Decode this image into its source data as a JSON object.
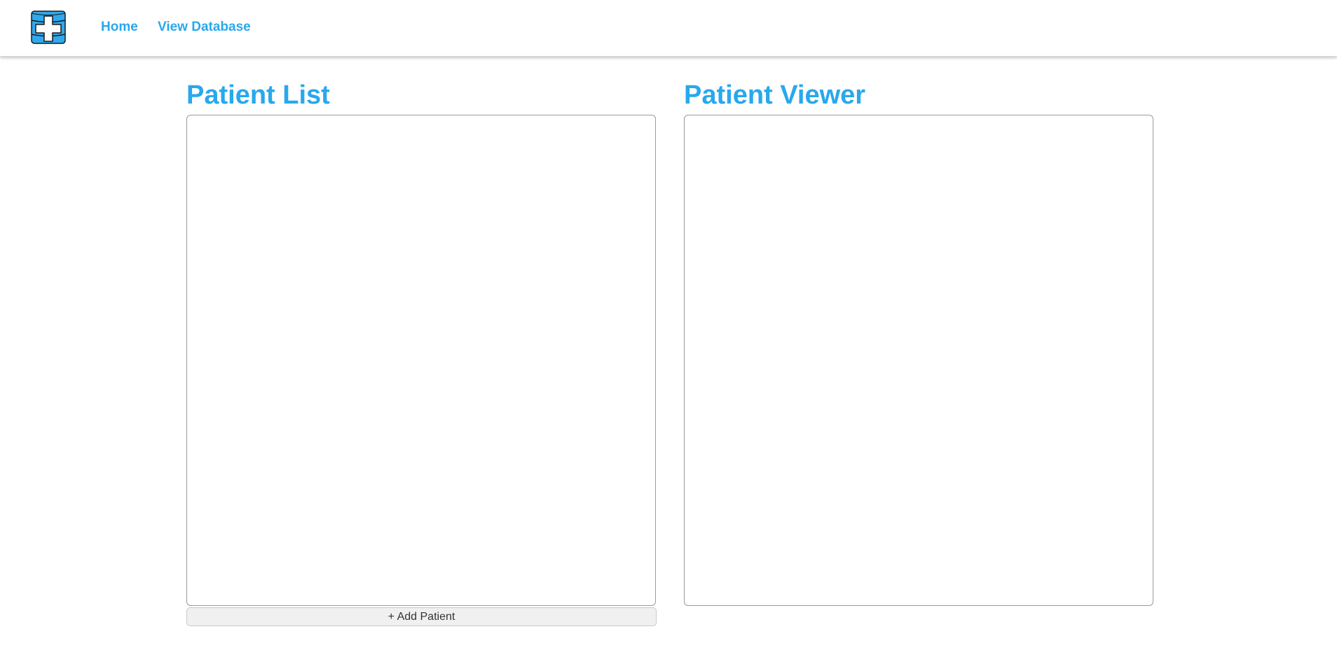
{
  "nav": {
    "logo_icon": "medical-cross-database-icon",
    "links": [
      {
        "label": "Home"
      },
      {
        "label": "View Database"
      }
    ]
  },
  "patient_list": {
    "title": "Patient List",
    "add_button_label": "+ Add Patient"
  },
  "patient_viewer": {
    "title": "Patient Viewer"
  },
  "colors": {
    "accent": "#29a8ec",
    "panel_border": "#9a9a9a",
    "button_bg": "#f0f0f0"
  }
}
